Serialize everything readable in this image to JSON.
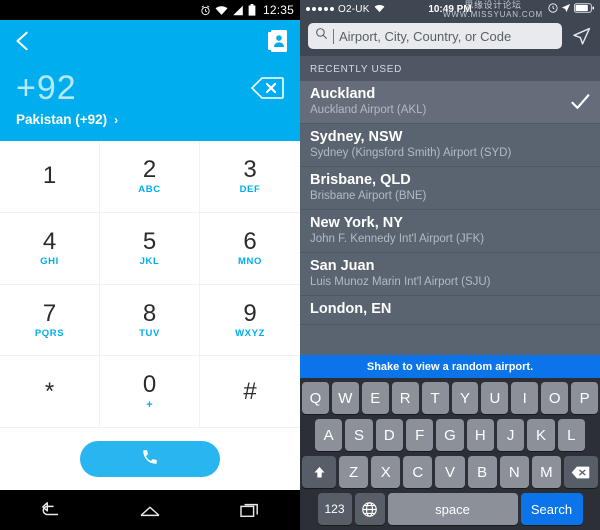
{
  "android": {
    "status": {
      "time": "12:35",
      "icons": [
        "alarm-icon",
        "wifi-icon",
        "signal-icon",
        "battery-icon"
      ]
    },
    "appbar": {
      "back": "back-arrow-icon",
      "contacts": "contacts-book-icon"
    },
    "number_display": {
      "value": "+92",
      "backspace": "backspace-icon"
    },
    "country": {
      "label": "Pakistan (+92)",
      "chevron": "›"
    },
    "keypad": [
      {
        "digit": "1",
        "sub": ""
      },
      {
        "digit": "2",
        "sub": "ABC"
      },
      {
        "digit": "3",
        "sub": "DEF"
      },
      {
        "digit": "4",
        "sub": "GHI"
      },
      {
        "digit": "5",
        "sub": "JKL"
      },
      {
        "digit": "6",
        "sub": "MNO"
      },
      {
        "digit": "7",
        "sub": "PQRS"
      },
      {
        "digit": "8",
        "sub": "TUV"
      },
      {
        "digit": "9",
        "sub": "WXYZ"
      },
      {
        "digit": "*",
        "sub": ""
      },
      {
        "digit": "0",
        "sub": "+"
      },
      {
        "digit": "#",
        "sub": ""
      }
    ],
    "call_button": "call-icon",
    "navbar": [
      "back-nav-icon",
      "home-nav-icon",
      "recents-nav-icon"
    ],
    "accent_color": "#00AEEF"
  },
  "ios": {
    "status": {
      "carrier": "O2-UK",
      "time": "10:49 PM",
      "signal_dots": 5
    },
    "watermark": {
      "line1": "思缘设计论坛",
      "line2": "WWW.MISSYUAN.COM"
    },
    "search": {
      "placeholder": "Airport, City, Country, or Code",
      "icon": "search-icon",
      "location_icon": "location-arrow-icon"
    },
    "section_header": "RECENTLY USED",
    "airports": [
      {
        "city": "Auckland",
        "airport": "Auckland Airport (AKL)",
        "selected": true
      },
      {
        "city": "Sydney, NSW",
        "airport": "Sydney (Kingsford Smith) Airport (SYD)",
        "selected": false
      },
      {
        "city": "Brisbane, QLD",
        "airport": "Brisbane Airport (BNE)",
        "selected": false
      },
      {
        "city": "New York, NY",
        "airport": "John F. Kennedy Int'l Airport (JFK)",
        "selected": false
      },
      {
        "city": "San Juan",
        "airport": "Luis Munoz Marin Int'l Airport (SJU)",
        "selected": false
      },
      {
        "city": "London, EN",
        "airport": "",
        "selected": false
      }
    ],
    "banner": "Shake to view a random airport.",
    "keyboard": {
      "row1": [
        "Q",
        "W",
        "E",
        "R",
        "T",
        "Y",
        "U",
        "I",
        "O",
        "P"
      ],
      "row2": [
        "A",
        "S",
        "D",
        "F",
        "G",
        "H",
        "J",
        "K",
        "L"
      ],
      "row3": [
        "Z",
        "X",
        "C",
        "V",
        "B",
        "N",
        "M"
      ],
      "shift": "shift-icon",
      "delete": "delete-icon",
      "numbers": "123",
      "globe": "globe-icon",
      "space": "space",
      "search": "Search"
    },
    "accent_color": "#0a74e8"
  }
}
